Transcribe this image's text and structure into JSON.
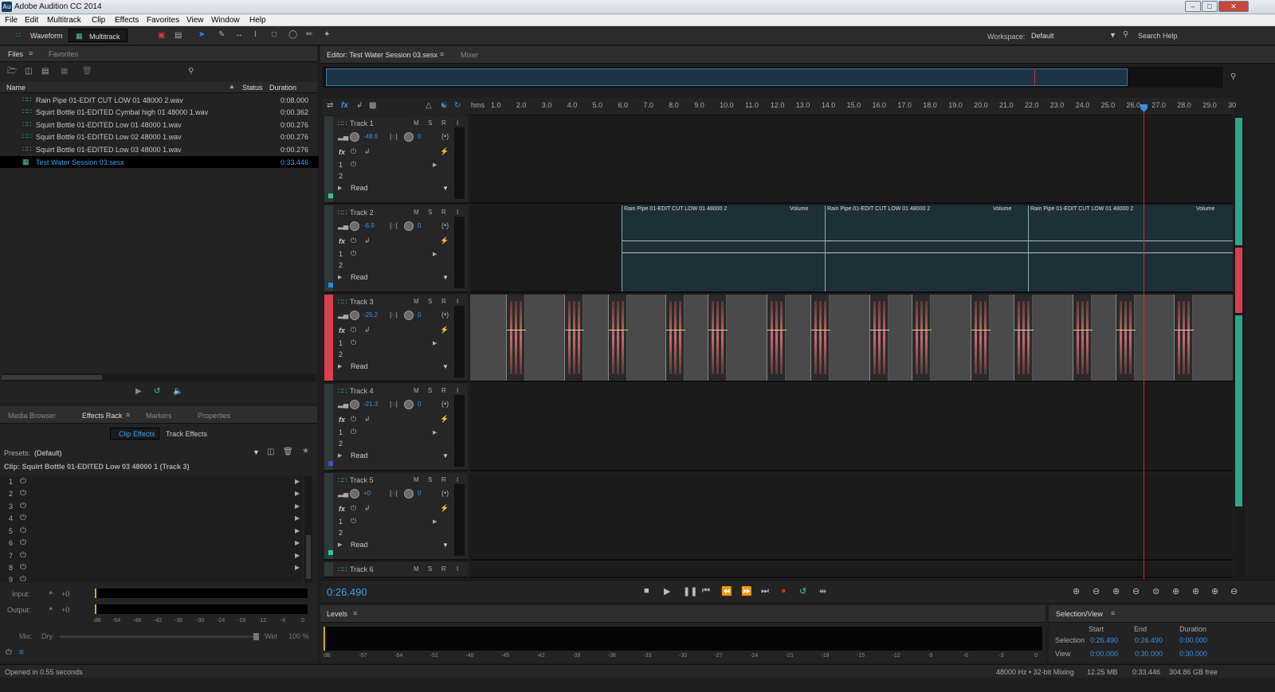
{
  "window": {
    "title": "Adobe Audition CC 2014",
    "app_icon": "Au"
  },
  "menu": [
    "File",
    "Edit",
    "Multitrack",
    "Clip",
    "Effects",
    "Favorites",
    "View",
    "Window",
    "Help"
  ],
  "toolbar": {
    "waveform": "Waveform",
    "multitrack": "Multitrack",
    "workspace_label": "Workspace:",
    "workspace_value": "Default",
    "search": "Search Help"
  },
  "files_panel": {
    "tabs": [
      "Files",
      "Favorites"
    ],
    "columns": {
      "name": "Name",
      "status": "Status",
      "duration": "Duration"
    },
    "items": [
      {
        "name": "Rain Pipe 01-EDIT CUT LOW 01 48000 2.wav",
        "duration": "0:08.000"
      },
      {
        "name": "Squirt Bottle 01-EDITED Cymbal high 01 48000 1.wav",
        "duration": "0:00.362"
      },
      {
        "name": "Squirt Bottle 01-EDITED Low 01 48000 1.wav",
        "duration": "0:00.276"
      },
      {
        "name": "Squirt Bottle 01-EDITED Low 02 48000 1.wav",
        "duration": "0:00.276"
      },
      {
        "name": "Squirt Bottle 01-EDITED Low 03 48000 1.wav",
        "duration": "0:00.276"
      },
      {
        "name": "Test Water Session 03.sesx",
        "duration": "0:33.446"
      }
    ]
  },
  "effects_panel": {
    "tabs": [
      "Media Browser",
      "Effects Rack",
      "Markers",
      "Properties"
    ],
    "subtabs": [
      "Clip Effects",
      "Track Effects"
    ],
    "presets_label": "Presets:",
    "presets_value": "(Default)",
    "clip_label": "Clip: Squirt Bottle 01-EDITED Low 03 48000 1 (Track 3)",
    "slots": [
      "1",
      "2",
      "3",
      "4",
      "5",
      "6",
      "7",
      "8",
      "9"
    ],
    "input_label": "Input:",
    "input_value": "+0",
    "output_label": "Output:",
    "output_value": "+0",
    "meter_ticks": [
      "dB",
      "-54",
      "-48",
      "-42",
      "-36",
      "-30",
      "-24",
      "-18",
      "-12",
      "-6",
      "0"
    ],
    "mix_label": "Mix:",
    "dry": "Dry",
    "wet": "Wet",
    "mix_value": "100 %"
  },
  "editor": {
    "tabs": [
      "Editor: Test Water Session 03.sesx",
      "Mixer"
    ],
    "time_unit": "hms",
    "ruler": [
      "1.0",
      "2.0",
      "3.0",
      "4.0",
      "5.0",
      "6.0",
      "7.0",
      "8.0",
      "9.0",
      "10.0",
      "11.0",
      "12.0",
      "13.0",
      "14.0",
      "15.0",
      "16.0",
      "17.0",
      "18.0",
      "19.0",
      "20.0",
      "21.0",
      "22.0",
      "23.0",
      "24.0",
      "25.0",
      "26.0",
      "27.0",
      "28.0",
      "29.0",
      "30"
    ],
    "tracks": [
      {
        "name": "Track 1",
        "volume": "-48.6",
        "pan": "0",
        "slot1": "1",
        "slot2": "2",
        "automation": "Read",
        "color": "#2fc59a"
      },
      {
        "name": "Track 2",
        "volume": "-6.9",
        "pan": "0",
        "slot1": "1",
        "slot2": "2",
        "automation": "Read",
        "color": "#1e8fd8"
      },
      {
        "name": "Track 3",
        "volume": "-25.2",
        "pan": "0",
        "slot1": "1",
        "slot2": "2",
        "automation": "Read",
        "color": "#e0404f"
      },
      {
        "name": "Track 4",
        "volume": "-21.3",
        "pan": "0",
        "slot1": "1",
        "slot2": "2",
        "automation": "Read",
        "color": "#4a4ad0"
      },
      {
        "name": "Track 5",
        "volume": "+0",
        "pan": "0",
        "slot1": "1",
        "slot2": "2",
        "automation": "Read",
        "color": "#2fc59a"
      },
      {
        "name": "Track 6"
      }
    ],
    "msr": [
      "M",
      "S",
      "R"
    ],
    "clips": [
      {
        "name": "Rain Pipe 01-EDIT CUT LOW 01 48000 2",
        "param": "Volume"
      },
      {
        "name": "Rain Pipe 01-EDIT CUT LOW 01 48000 2",
        "param": "Volume"
      },
      {
        "name": "Rain Pipe 01-EDIT CUT LOW 01 48000 2",
        "param": "Volume"
      }
    ],
    "current_time": "0:26.490"
  },
  "levels": {
    "title": "Levels",
    "ticks": [
      "dB",
      "-57",
      "-54",
      "-51",
      "-48",
      "-45",
      "-42",
      "-39",
      "-36",
      "-33",
      "-30",
      "-27",
      "-24",
      "-21",
      "-18",
      "-15",
      "-12",
      "-9",
      "-6",
      "-3",
      "0"
    ]
  },
  "selection_view": {
    "title": "Selection/View",
    "cols": [
      "Start",
      "End",
      "Duration"
    ],
    "selection": {
      "label": "Selection",
      "start": "0:26.490",
      "end": "0:26.490",
      "duration": "0:00.000"
    },
    "view": {
      "label": "View",
      "start": "0:00.000",
      "end": "0:30.000",
      "duration": "0:30.000"
    }
  },
  "status": {
    "left": "Opened in 0.55 seconds",
    "format": "48000 Hz • 32-bit Mixing",
    "mem": "12.25 MB",
    "dur": "0:33.446",
    "free": "304.86 GB free"
  }
}
